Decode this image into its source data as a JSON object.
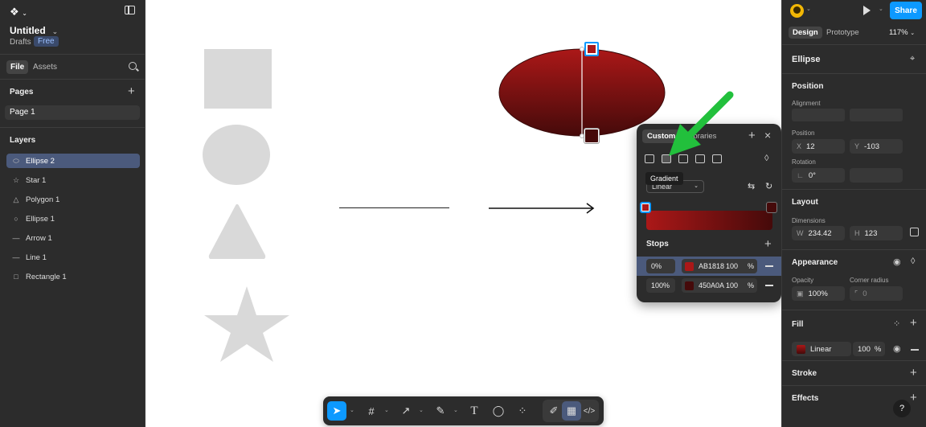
{
  "file": {
    "title": "Untitled",
    "location": "Drafts",
    "plan_badge": "Free"
  },
  "left_tabs": {
    "file": "File",
    "assets": "Assets"
  },
  "pages": {
    "heading": "Pages",
    "items": [
      "Page 1"
    ]
  },
  "layers": {
    "heading": "Layers",
    "items": [
      {
        "label": "Ellipse 2",
        "icon": "ellipse-icon",
        "glyph": "⬭",
        "selected": true
      },
      {
        "label": "Star 1",
        "icon": "star-icon",
        "glyph": "☆"
      },
      {
        "label": "Polygon 1",
        "icon": "triangle-icon",
        "glyph": "△"
      },
      {
        "label": "Ellipse 1",
        "icon": "circle-icon",
        "glyph": "○"
      },
      {
        "label": "Arrow 1",
        "icon": "arrow-icon",
        "glyph": "—"
      },
      {
        "label": "Line 1",
        "icon": "line-icon",
        "glyph": "—"
      },
      {
        "label": "Rectangle 1",
        "icon": "rectangle-icon",
        "glyph": "□"
      }
    ]
  },
  "header": {
    "share": "Share",
    "tab_design": "Design",
    "tab_prototype": "Prototype",
    "zoom": "117%"
  },
  "selection": {
    "name": "Ellipse"
  },
  "position": {
    "heading": "Position",
    "alignment_label": "Alignment",
    "position_label": "Position",
    "x": "12",
    "y": "-103",
    "rotation_label": "Rotation",
    "rotation": "0°"
  },
  "layout": {
    "heading": "Layout",
    "dimensions_label": "Dimensions",
    "w": "234.42",
    "h": "123"
  },
  "appearance": {
    "heading": "Appearance",
    "opacity_label": "Opacity",
    "opacity": "100%",
    "radius_label": "Corner radius",
    "radius": "0"
  },
  "fill": {
    "heading": "Fill",
    "type": "Linear",
    "opacity": "100",
    "pct": "%"
  },
  "stroke": {
    "heading": "Stroke"
  },
  "effects": {
    "heading": "Effects"
  },
  "popup": {
    "tab_custom": "Custom",
    "tab_libraries": "Libraries",
    "tooltip": "Gradient",
    "gradient_type": "Linear",
    "stops_heading": "Stops",
    "stops": [
      {
        "position": "0%",
        "hex": "AB1818",
        "opacity": "100",
        "pct": "%",
        "color": "#AB1818"
      },
      {
        "position": "100%",
        "hex": "450A0A",
        "opacity": "100",
        "pct": "%",
        "color": "#450A0A"
      }
    ]
  },
  "colors": {
    "accent": "#0d99ff",
    "highlight": "#4b5a7c",
    "annotation_arrow": "#22c03c",
    "shape_gray": "#d9d9d9"
  },
  "help": "?"
}
